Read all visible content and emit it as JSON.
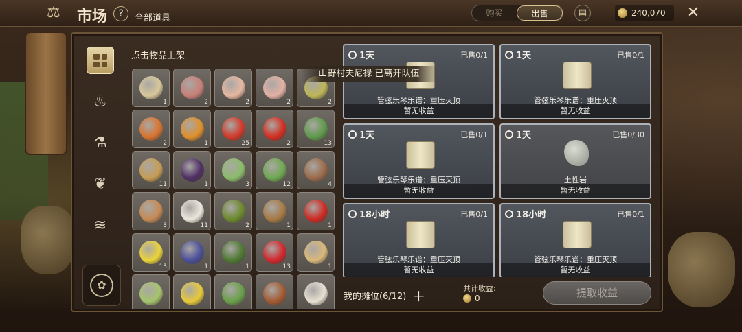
{
  "header": {
    "title": "市场",
    "help": "?",
    "category_label": "全部道具",
    "tabs": [
      {
        "label": "购买",
        "active": false
      },
      {
        "label": "出售",
        "active": true
      }
    ],
    "coins": "240,070",
    "close_icon": "close-icon",
    "scale_icon": "scale-icon",
    "log_icon": "document-icon"
  },
  "sidebar": {
    "categories": [
      {
        "icon": "grid-icon",
        "active": true
      },
      {
        "icon": "pouch-icon",
        "active": false
      },
      {
        "icon": "potion-icon",
        "active": false
      },
      {
        "icon": "plant-icon",
        "active": false
      },
      {
        "icon": "fish-icon",
        "active": false
      }
    ],
    "bottom_icon": "paw-badge-icon"
  },
  "inventory": {
    "hint": "点击物品上架",
    "items": [
      {
        "icon": "bottle-icon",
        "count": "1",
        "color": "#d8c89a"
      },
      {
        "icon": "meat-icon",
        "count": "2",
        "color": "#c88078"
      },
      {
        "icon": "drumstick-icon",
        "count": "2",
        "color": "#e5b7a1"
      },
      {
        "icon": "meat-icon",
        "count": "2",
        "color": "#e4b0a4"
      },
      {
        "icon": "egg-icon",
        "count": "2",
        "color": "#bfb657"
      },
      {
        "icon": "onion-icon",
        "count": "2",
        "color": "#d8742f"
      },
      {
        "icon": "pumpkin-icon",
        "count": "1",
        "color": "#e0902a"
      },
      {
        "icon": "tomato-icon",
        "count": "25",
        "color": "#d23a2a"
      },
      {
        "icon": "pepper-icon",
        "count": "2",
        "color": "#d42e20"
      },
      {
        "icon": "leaf-icon",
        "count": "13",
        "color": "#5f9a4c"
      },
      {
        "icon": "potato-icon",
        "count": "11",
        "color": "#c79d55"
      },
      {
        "icon": "eggplant-icon",
        "count": "1",
        "color": "#4e2e64"
      },
      {
        "icon": "cabbage-icon",
        "count": "3",
        "color": "#8cbc6a"
      },
      {
        "icon": "pod-icon",
        "count": "12",
        "color": "#6fa851"
      },
      {
        "icon": "mushroom-icon",
        "count": "4",
        "color": "#9c6b4a"
      },
      {
        "icon": "mushroom-icon",
        "count": "3",
        "color": "#c68a55"
      },
      {
        "icon": "mushroom-icon",
        "count": "11",
        "color": "#ece7dc"
      },
      {
        "icon": "olive-icon",
        "count": "2",
        "color": "#6d8a2e"
      },
      {
        "icon": "walnut-icon",
        "count": "1",
        "color": "#a77a45"
      },
      {
        "icon": "apple-icon",
        "count": "1",
        "color": "#cf2a24"
      },
      {
        "icon": "lemon-icon",
        "count": "13",
        "color": "#ecd43a"
      },
      {
        "icon": "blueberry-icon",
        "count": "1",
        "color": "#4a4f9a"
      },
      {
        "icon": "avocado-icon",
        "count": "1",
        "color": "#4f7a32"
      },
      {
        "icon": "strawberry-icon",
        "count": "13",
        "color": "#d4262c"
      },
      {
        "icon": "flour-icon",
        "count": "1",
        "color": "#d9b87a"
      },
      {
        "icon": "gourd-icon",
        "count": "",
        "color": "#a6c46c"
      },
      {
        "icon": "corn-icon",
        "count": "",
        "color": "#e8c93a"
      },
      {
        "icon": "peas-icon",
        "count": "",
        "color": "#6aa04a"
      },
      {
        "icon": "cinnamon-icon",
        "count": "",
        "color": "#a45a32"
      },
      {
        "icon": "garlic-icon",
        "count": "",
        "color": "#e6e0d2"
      }
    ]
  },
  "listings": [
    {
      "time": "1天",
      "sold": "已售0/1",
      "item": "管弦乐琴乐谱：重压灭顶",
      "earnings": "暂无收益",
      "type": "scroll"
    },
    {
      "time": "1天",
      "sold": "已售0/1",
      "item": "管弦乐琴乐谱：重压灭顶",
      "earnings": "暂无收益",
      "type": "scroll"
    },
    {
      "time": "1天",
      "sold": "已售0/1",
      "item": "管弦乐琴乐谱：重压灭顶",
      "earnings": "暂无收益",
      "type": "scroll"
    },
    {
      "time": "1天",
      "sold": "已售0/30",
      "item": "土性岩",
      "earnings": "暂无收益",
      "type": "rock"
    },
    {
      "time": "18小时",
      "sold": "已售0/1",
      "item": "管弦乐琴乐谱：重压灭顶",
      "earnings": "暂无收益",
      "type": "scroll"
    },
    {
      "time": "18小时",
      "sold": "已售0/1",
      "item": "管弦乐琴乐谱：重压灭顶",
      "earnings": "暂无收益",
      "type": "scroll"
    }
  ],
  "toast": "山野村夫尼禄 已离开队伍",
  "footer": {
    "stall_label": "我的摊位(6/12)",
    "add_icon": "plus-icon",
    "total_label": "共计收益:",
    "total_value": "0",
    "claim_button": "提取收益"
  }
}
